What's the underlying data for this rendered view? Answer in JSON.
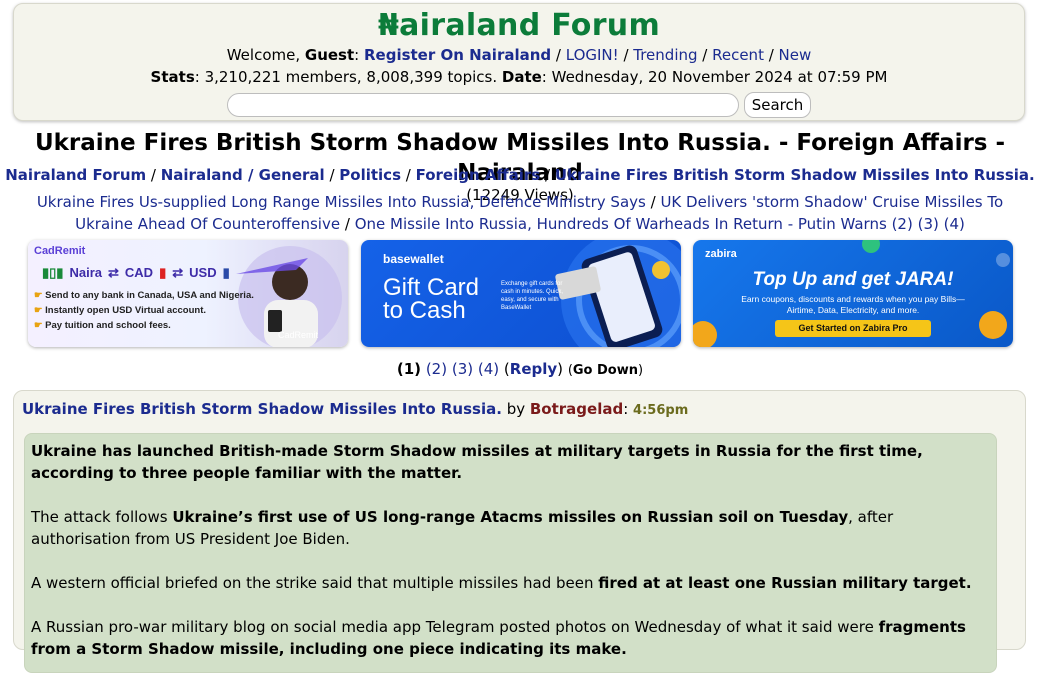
{
  "header": {
    "logo": "₦airaland Forum",
    "welcome_prefix": "Welcome, ",
    "guest": "Guest",
    "register": "Register On Nairaland",
    "login": "LOGIN!",
    "trending": "Trending",
    "recent": "Recent",
    "new": "New",
    "stats_label": "Stats",
    "stats_value": "3,210,221 members, 8,008,399 topics.",
    "date_label": "Date",
    "date_value": "Wednesday, 20 November 2024 at 07:59 PM",
    "search_button": "Search",
    "search_placeholder": ""
  },
  "page_title": "Ukraine Fires British Storm Shadow Missiles Into Russia. - Foreign Affairs - Nairaland",
  "breadcrumb": {
    "forum": "Nairaland Forum",
    "general": "Nairaland / General",
    "politics": "Politics",
    "foreign": "Foreign Affairs",
    "topic": "Ukraine Fires British Storm Shadow Missiles Into Russia.",
    "views": "(12249 Views)"
  },
  "related": {
    "item1": "Ukraine Fires Us-supplied Long Range Missiles Into Russia, Defence Ministry Says",
    "item2": "UK Delivers 'storm Shadow' Cruise Missiles To Ukraine Ahead Of Counteroffensive",
    "item3": "One Missile Into Russia, Hundreds Of Warheads In Return - Putin Warns",
    "pages": [
      "(2)",
      "(3)",
      "(4)"
    ]
  },
  "ads": {
    "ad1": {
      "brand": "CadRemit",
      "currencies": [
        "Naira",
        "CAD",
        "USD"
      ],
      "bullets": [
        "Send to any bank in Canada, USA and Nigeria.",
        "Instantly open USD Virtual account.",
        "Pay tuition and school fees."
      ],
      "badge": "CadRemit"
    },
    "ad2": {
      "brand": "basewallet",
      "headline1": "Gift Card",
      "headline2": "to Cash",
      "small": "Exchange gift cards for cash in minutes. Quick, easy, and secure with BaseWallet"
    },
    "ad3": {
      "brand": "zabira",
      "headline": "Top Up and get JARA!",
      "sub": "Earn coupons, discounts and rewards when you pay Bills—Airtime, Data, Electricity, and more.",
      "cta": "Get Started on Zabira Pro"
    }
  },
  "pager": {
    "current": "(1)",
    "pages": [
      "(2)",
      "(3)",
      "(4)"
    ],
    "reply": "Reply",
    "goto": "Go Down"
  },
  "post": {
    "title": "Ukraine Fires British Storm Shadow Missiles Into Russia.",
    "by": "by",
    "author": "Botragelad",
    "time": "4:56pm",
    "p1_bold": "Ukraine has launched British-made Storm Shadow missiles at military targets in Russia for the first time, according to three people familiar with the matter.",
    "p2_a": "The attack follows ",
    "p2_b": "Ukraine’s first use of US long-range Atacms missiles on Russian soil on Tuesday",
    "p2_c": ", after authorisation from US President Joe Biden.",
    "p3_a": "A western official briefed on the strike said that multiple missiles had been ",
    "p3_b": "fired at at least one Russian military target.",
    "p4_a": "A Russian pro-war military blog on social media app Telegram posted photos on Wednesday of what it said were ",
    "p4_b": "fragments from a Storm Shadow missile, including one piece indicating its make."
  },
  "colors": {
    "logo_green": "#0c7c3a",
    "link_blue": "#1b2b8f",
    "post_body_bg": "#d2e0c8",
    "header_bg": "#f4f4ec"
  }
}
